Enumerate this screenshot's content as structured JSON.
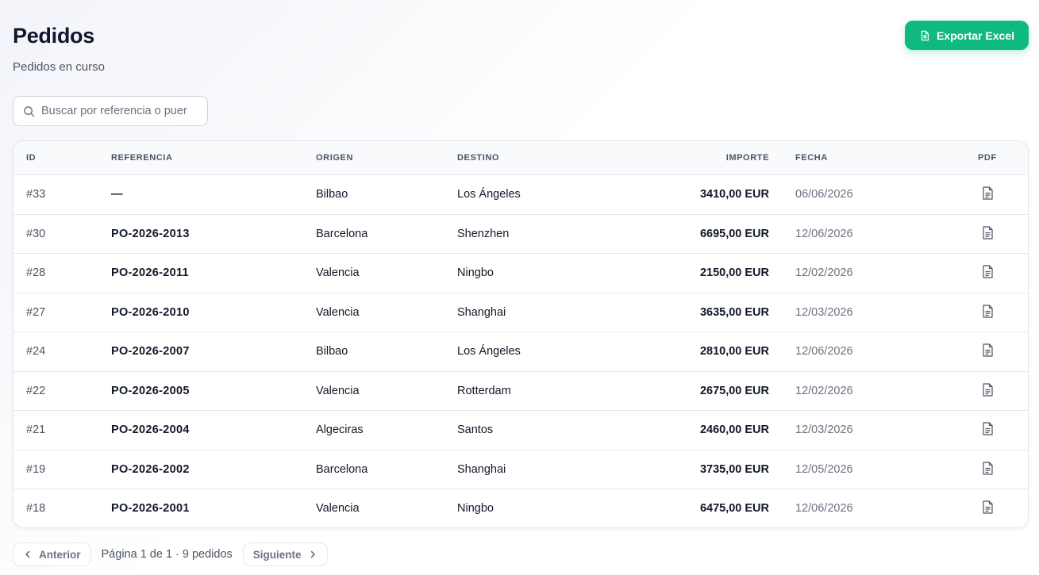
{
  "header": {
    "title": "Pedidos",
    "subtitle": "Pedidos en curso",
    "export_label": "Exportar Excel"
  },
  "search": {
    "placeholder": "Buscar por referencia o puer",
    "value": ""
  },
  "table": {
    "columns": {
      "id": "ID",
      "ref": "REFERENCIA",
      "orig": "ORIGEN",
      "dest": "DESTINO",
      "imp": "IMPORTE",
      "date": "FECHA",
      "pdf": "PDF"
    },
    "rows": [
      {
        "id": "#33",
        "ref": "—",
        "orig": "Bilbao",
        "dest": "Los Ángeles",
        "imp": "3410,00 EUR",
        "date": "06/06/2026"
      },
      {
        "id": "#30",
        "ref": "PO-2026-2013",
        "orig": "Barcelona",
        "dest": "Shenzhen",
        "imp": "6695,00 EUR",
        "date": "12/06/2026"
      },
      {
        "id": "#28",
        "ref": "PO-2026-2011",
        "orig": "Valencia",
        "dest": "Ningbo",
        "imp": "2150,00 EUR",
        "date": "12/02/2026"
      },
      {
        "id": "#27",
        "ref": "PO-2026-2010",
        "orig": "Valencia",
        "dest": "Shanghai",
        "imp": "3635,00 EUR",
        "date": "12/03/2026"
      },
      {
        "id": "#24",
        "ref": "PO-2026-2007",
        "orig": "Bilbao",
        "dest": "Los Ángeles",
        "imp": "2810,00 EUR",
        "date": "12/06/2026"
      },
      {
        "id": "#22",
        "ref": "PO-2026-2005",
        "orig": "Valencia",
        "dest": "Rotterdam",
        "imp": "2675,00 EUR",
        "date": "12/02/2026"
      },
      {
        "id": "#21",
        "ref": "PO-2026-2004",
        "orig": "Algeciras",
        "dest": "Santos",
        "imp": "2460,00 EUR",
        "date": "12/03/2026"
      },
      {
        "id": "#19",
        "ref": "PO-2026-2002",
        "orig": "Barcelona",
        "dest": "Shanghai",
        "imp": "3735,00 EUR",
        "date": "12/05/2026"
      },
      {
        "id": "#18",
        "ref": "PO-2026-2001",
        "orig": "Valencia",
        "dest": "Ningbo",
        "imp": "6475,00 EUR",
        "date": "12/06/2026"
      }
    ]
  },
  "pagination": {
    "prev_label": "Anterior",
    "info": "Página 1 de 1 · 9 pedidos",
    "next_label": "Siguiente"
  },
  "icons": {
    "export": "file-spreadsheet-icon",
    "search": "search-icon",
    "pdf": "file-text-icon",
    "prev": "chevron-left-icon",
    "next": "chevron-right-icon"
  },
  "colors": {
    "accent": "#10b981",
    "text": "#111827",
    "muted": "#6b7280",
    "border": "#e5e7eb"
  }
}
